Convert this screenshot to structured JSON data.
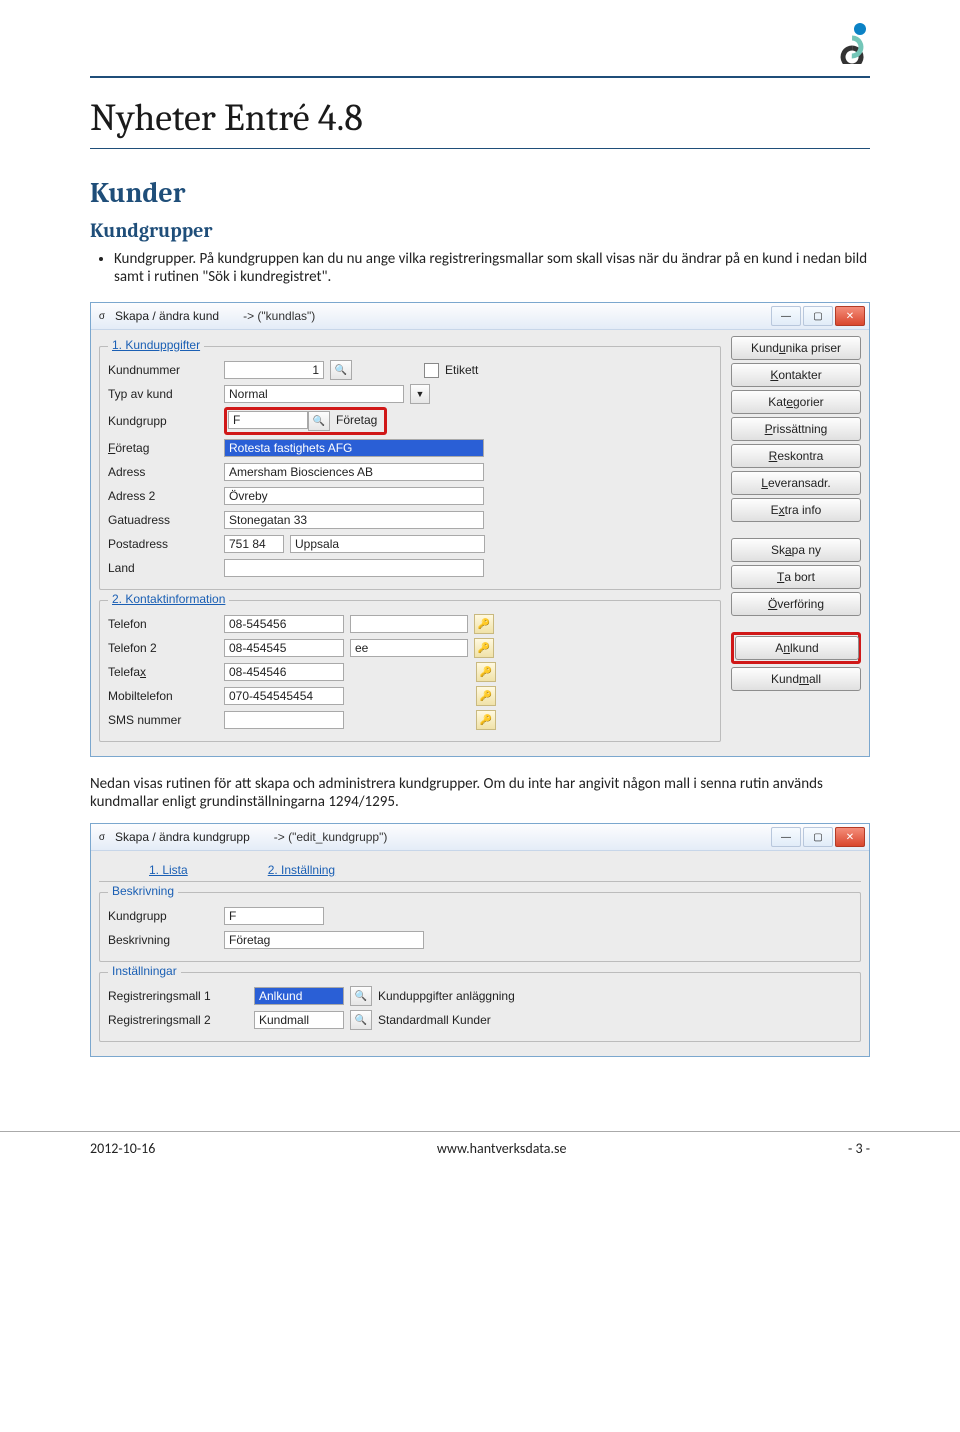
{
  "page": {
    "title": "Nyheter Entré 4.8",
    "h2": "Kunder",
    "h3": "Kundgrupper",
    "bullet": "Kundgrupper. På kundgruppen kan du nu ange vilka registreringsmallar som skall visas när du ändrar på en kund i nedan bild samt i rutinen \"Sök i kundregistret\".",
    "mid_text": "Nedan visas rutinen för att skapa och administrera kundgrupper. Om du inte har angivit någon mall i senna rutin används kundmallar enligt grundinställningarna 1294/1295."
  },
  "footer": {
    "date": "2012-10-16",
    "url": "www.hantverksdata.se",
    "pg": "- 3 -"
  },
  "win1": {
    "title": "Skapa / ändra kund",
    "title_suffix": "-> (\"kundlas\")",
    "group1_title": "1. Kunduppgifter",
    "labels": {
      "kundnummer": "Kundnummer",
      "typ": "Typ av kund",
      "kundgrupp": "Kundgrupp",
      "foretag": "Företag",
      "adress": "Adress",
      "adress2": "Adress 2",
      "gatuadress": "Gatuadress",
      "postadress": "Postadress",
      "land": "Land",
      "etikett": "Etikett"
    },
    "values": {
      "kundnummer": "1",
      "typ": "Normal",
      "kundgrupp_code": "F",
      "kundgrupp_name": "Företag",
      "foretag": "Rotesta fastighets AFG",
      "adress": "Amersham Biosciences AB",
      "adress2": "Övreby",
      "gatuadress": "Stonegatan 33",
      "postnr": "751 84",
      "postort": "Uppsala",
      "land": ""
    },
    "group2_title": "2. Kontaktinformation",
    "labels2": {
      "telefon": "Telefon",
      "telefon2": "Telefon 2",
      "telefax": "Telefax",
      "mobil": "Mobiltelefon",
      "sms": "SMS nummer"
    },
    "values2": {
      "telefon": "08-545456",
      "telefon2": "08-454545",
      "telefon2_note": "ee",
      "telefax": "08-454546",
      "mobil": "070-454545454",
      "sms": ""
    },
    "side": {
      "kundunika": "Kundunika priser",
      "kontakter": "Kontakter",
      "kategorier": "Kategorier",
      "prissattning": "Prissättning",
      "reskontra": "Reskontra",
      "leverans": "Leveransadr.",
      "extra": "Extra info",
      "skapa": "Skapa ny",
      "tabort": "Ta bort",
      "overforing": "Överföring",
      "anlkund": "Anlkund",
      "kundmall": "Kundmall"
    }
  },
  "win2": {
    "title": "Skapa / ändra kundgrupp",
    "title_suffix": "-> (\"edit_kundgrupp\")",
    "tab1": "1. Lista",
    "tab2": "2. Inställning",
    "group1_title": "Beskrivning",
    "group2_title": "Inställningar",
    "labels": {
      "kundgrupp": "Kundgrupp",
      "beskrivning": "Beskrivning",
      "reg1": "Registreringsmall 1",
      "reg2": "Registreringsmall 2"
    },
    "values": {
      "kundgrupp": "F",
      "beskrivning": "Företag",
      "reg1": "Anlkund",
      "reg1_desc": "Kunduppgifter anläggning",
      "reg2": "Kundmall",
      "reg2_desc": "Standardmall Kunder"
    }
  }
}
